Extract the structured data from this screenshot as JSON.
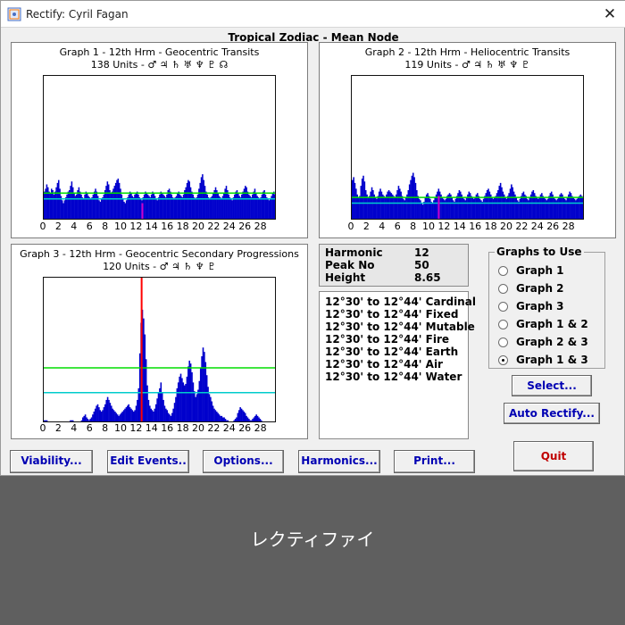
{
  "window": {
    "title": "Rectify: Cyril Fagan",
    "close_symbol": "✕",
    "icon": "app-icon"
  },
  "main_title": "Tropical Zodiac - Mean Node",
  "graphs": [
    {
      "title": "Graph 1 - 12th Hrm - Geocentric Transits",
      "subtitle": "138 Units - ♂ ♃ ♄ ♅ ♆ ♇ ☊",
      "x_labels": [
        "0",
        "2",
        "4",
        "6",
        "8",
        "10",
        "12",
        "14",
        "16",
        "18",
        "20",
        "22",
        "24",
        "26",
        "28"
      ]
    },
    {
      "title": "Graph 2 - 12th Hrm - Heliocentric Transits",
      "subtitle": "119 Units - ♂ ♃ ♄ ♅ ♆ ♇",
      "x_labels": [
        "0",
        "2",
        "4",
        "6",
        "8",
        "10",
        "12",
        "14",
        "16",
        "18",
        "20",
        "22",
        "24",
        "26",
        "28"
      ]
    },
    {
      "title": "Graph 3 - 12th Hrm - Geocentric Secondary Progressions",
      "subtitle": "120 Units - ♂ ♃ ♄ ♆ ♇",
      "x_labels": [
        "0",
        "2",
        "4",
        "6",
        "8",
        "10",
        "12",
        "14",
        "16",
        "18",
        "20",
        "22",
        "24",
        "26",
        "28"
      ]
    }
  ],
  "info": {
    "rows": [
      {
        "label": "Harmonic",
        "value": "12"
      },
      {
        "label": "Peak No",
        "value": "50"
      },
      {
        "label": "Height",
        "value": "8.65"
      }
    ]
  },
  "ranges": [
    "12°30' to 12°44' Cardinal",
    "12°30' to 12°44' Fixed",
    "12°30' to 12°44' Mutable",
    "12°30' to 12°44' Fire",
    "12°30' to 12°44' Earth",
    "12°30' to 12°44' Air",
    "12°30' to 12°44' Water"
  ],
  "graphs_to_use": {
    "title": "Graphs to Use",
    "options": [
      "Graph 1",
      "Graph 2",
      "Graph 3",
      "Graph 1 & 2",
      "Graph 2 & 3",
      "Graph 1 & 3"
    ],
    "selected_index": 5
  },
  "buttons": {
    "select": "Select...",
    "auto_rectify": "Auto Rectify...",
    "viability": "Viability...",
    "edit_events": "Edit Events..",
    "options": "Options...",
    "harmonics": "Harmonics...",
    "print": "Print...",
    "quit": "Quit"
  },
  "caption": "レクティファイ",
  "colors": {
    "bars": "#0000cc",
    "red_marker": "#ff0000",
    "magenta_marker": "#cc00cc",
    "green_line": "#00dd00",
    "cyan_line": "#00cccc"
  },
  "chart_data": [
    {
      "type": "bar",
      "title": "Graph 1 - 12th Hrm - Geocentric Transits",
      "subtitle": "138 Units - ♂ ♃ ♄ ♅ ♆ ♇ ☊",
      "xlim": [
        0,
        30
      ],
      "ylim": [
        0,
        10
      ],
      "x_ticks": [
        0,
        2,
        4,
        6,
        8,
        10,
        12,
        14,
        16,
        18,
        20,
        22,
        24,
        26,
        28
      ],
      "reference_lines": [
        1.9,
        1.5
      ],
      "marker_x": 12.7,
      "marker_y": 1.2,
      "values": [
        2.0,
        2.2,
        2.5,
        2.3,
        2.0,
        1.9,
        2.2,
        2.1,
        1.8,
        2.0,
        2.3,
        2.6,
        2.8,
        2.2,
        1.7,
        1.4,
        1.2,
        1.4,
        1.6,
        1.8,
        2.0,
        2.1,
        2.4,
        2.7,
        2.3,
        1.9,
        1.7,
        1.8,
        2.1,
        2.3,
        2.0,
        1.8,
        1.6,
        1.5,
        1.8,
        2.0,
        1.9,
        1.7,
        1.6,
        1.5,
        1.6,
        1.8,
        2.0,
        2.2,
        2.0,
        1.7,
        1.4,
        1.3,
        1.5,
        1.6,
        1.8,
        2.1,
        2.4,
        2.7,
        2.5,
        2.1,
        1.9,
        2.0,
        2.2,
        2.4,
        2.6,
        2.8,
        2.9,
        2.6,
        2.2,
        1.8,
        1.5,
        1.3,
        1.2,
        1.4,
        1.6,
        1.8,
        2.0,
        1.9,
        1.7,
        1.6,
        1.8,
        1.9,
        2.0,
        1.8,
        1.6,
        1.5,
        1.4,
        1.6,
        1.8,
        2.0,
        1.9,
        1.8,
        1.7,
        1.6,
        1.8,
        2.0,
        1.9,
        1.7,
        1.5,
        1.4,
        1.6,
        1.8,
        2.0,
        1.9,
        1.8,
        1.7,
        1.6,
        1.8,
        2.1,
        2.2,
        2.0,
        1.8,
        1.6,
        1.5,
        1.6,
        1.7,
        1.9,
        2.0,
        1.8,
        1.7,
        1.6,
        1.8,
        2.1,
        2.3,
        2.6,
        2.8,
        2.7,
        2.3,
        2.0,
        1.8,
        1.6,
        1.5,
        1.6,
        1.8,
        2.2,
        2.6,
        3.0,
        3.2,
        2.8,
        2.4,
        2.0,
        1.8,
        1.6,
        1.5,
        1.6,
        1.7,
        1.9,
        2.1,
        2.3,
        2.1,
        1.9,
        1.7,
        1.6,
        1.5,
        1.7,
        1.9,
        2.2,
        2.4,
        2.1,
        1.8,
        1.6,
        1.5,
        1.4,
        1.6,
        1.8,
        2.0,
        2.1,
        1.9,
        1.7,
        1.6,
        1.8,
        2.0,
        2.2,
        2.4,
        2.3,
        2.0,
        1.8,
        1.7,
        1.6,
        1.8,
        2.0,
        2.2,
        1.9,
        1.7,
        1.6,
        1.5,
        1.6,
        1.8,
        2.0,
        2.1,
        1.8,
        1.6,
        1.5,
        1.4,
        1.5,
        1.7,
        1.9,
        2.0,
        1.8,
        1.6
      ]
    },
    {
      "type": "bar",
      "title": "Graph 2 - 12th Hrm - Heliocentric Transits",
      "subtitle": "119 Units - ♂ ♃ ♄ ♅ ♆ ♇",
      "xlim": [
        0,
        30
      ],
      "ylim": [
        0,
        10
      ],
      "x_ticks": [
        0,
        2,
        4,
        6,
        8,
        10,
        12,
        14,
        16,
        18,
        20,
        22,
        24,
        26,
        28
      ],
      "reference_lines": [
        1.6,
        1.2
      ],
      "marker_x": 11.2,
      "marker_y": 1.7,
      "values": [
        2.8,
        3.0,
        2.6,
        2.2,
        1.8,
        1.6,
        1.7,
        2.4,
        2.9,
        3.1,
        2.7,
        2.1,
        1.8,
        1.6,
        1.7,
        2.0,
        2.3,
        2.1,
        1.8,
        1.6,
        1.5,
        1.7,
        2.0,
        2.2,
        2.0,
        1.8,
        1.7,
        1.6,
        1.8,
        2.0,
        2.1,
        2.0,
        1.9,
        1.8,
        1.7,
        1.6,
        1.8,
        2.1,
        2.4,
        2.2,
        2.0,
        1.7,
        1.5,
        1.4,
        1.6,
        1.8,
        2.1,
        2.5,
        2.8,
        3.1,
        3.3,
        3.0,
        2.6,
        2.1,
        1.7,
        1.5,
        1.4,
        1.2,
        1.1,
        1.3,
        1.6,
        1.8,
        1.9,
        1.7,
        1.5,
        1.3,
        1.2,
        1.4,
        1.6,
        1.8,
        2.0,
        2.2,
        2.0,
        1.8,
        1.6,
        1.5,
        1.4,
        1.5,
        1.7,
        1.8,
        1.9,
        1.8,
        1.6,
        1.4,
        1.3,
        1.5,
        1.7,
        1.9,
        2.1,
        2.0,
        1.8,
        1.6,
        1.5,
        1.4,
        1.6,
        1.8,
        2.0,
        1.9,
        1.7,
        1.6,
        1.5,
        1.6,
        1.8,
        1.9,
        1.7,
        1.5,
        1.4,
        1.3,
        1.5,
        1.7,
        1.9,
        2.1,
        2.2,
        2.0,
        1.8,
        1.6,
        1.5,
        1.6,
        1.7,
        1.9,
        2.1,
        2.4,
        2.6,
        2.3,
        2.0,
        1.8,
        1.6,
        1.5,
        1.7,
        1.9,
        2.2,
        2.5,
        2.3,
        2.0,
        1.8,
        1.6,
        1.4,
        1.3,
        1.5,
        1.7,
        1.9,
        2.0,
        1.8,
        1.7,
        1.5,
        1.4,
        1.6,
        1.8,
        2.0,
        2.1,
        1.9,
        1.7,
        1.6,
        1.5,
        1.6,
        1.8,
        1.9,
        1.7,
        1.6,
        1.5,
        1.4,
        1.5,
        1.7,
        1.9,
        2.0,
        1.8,
        1.6,
        1.5,
        1.4,
        1.5,
        1.6,
        1.8,
        1.9,
        1.8,
        1.6,
        1.5,
        1.4,
        1.6,
        1.8,
        2.0,
        1.9,
        1.7,
        1.6,
        1.5,
        1.4,
        1.5,
        1.6,
        1.7,
        1.8,
        1.7,
        1.6,
        1.5
      ]
    },
    {
      "type": "bar",
      "title": "Graph 3 - 12th Hrm - Geocentric Secondary Progressions",
      "subtitle": "120 Units - ♂ ♃ ♄ ♆ ♇",
      "xlim": [
        0,
        30
      ],
      "ylim": [
        0,
        10
      ],
      "x_ticks": [
        0,
        2,
        4,
        6,
        8,
        10,
        12,
        14,
        16,
        18,
        20,
        22,
        24,
        26,
        28
      ],
      "reference_lines": [
        3.8,
        2.1
      ],
      "marker_x": 12.6,
      "marker_y": 10.0,
      "values": [
        0.2,
        0.2,
        0.2,
        0.1,
        0.1,
        0.1,
        0.1,
        0.1,
        0.1,
        0.1,
        0.1,
        0.1,
        0.1,
        0.1,
        0.1,
        0.1,
        0.1,
        0.1,
        0.1,
        0.1,
        0.1,
        0.2,
        0.2,
        0.2,
        0.1,
        0.1,
        0.1,
        0.1,
        0.1,
        0.1,
        0.2,
        0.4,
        0.5,
        0.6,
        0.4,
        0.3,
        0.2,
        0.3,
        0.4,
        0.6,
        0.8,
        1.0,
        1.2,
        1.3,
        1.1,
        0.9,
        0.8,
        0.9,
        1.1,
        1.3,
        1.6,
        1.8,
        1.6,
        1.4,
        1.2,
        1.0,
        0.9,
        0.8,
        0.7,
        0.6,
        0.5,
        0.6,
        0.7,
        0.8,
        0.9,
        1.0,
        1.1,
        1.2,
        1.3,
        1.1,
        1.0,
        0.9,
        0.8,
        0.9,
        1.2,
        1.6,
        2.4,
        4.8,
        6.9,
        7.8,
        7.2,
        6.1,
        4.4,
        2.6,
        1.6,
        1.2,
        1.0,
        0.9,
        0.8,
        1.0,
        1.3,
        1.7,
        2.1,
        2.4,
        2.8,
        2.1,
        1.6,
        1.2,
        1.0,
        0.9,
        0.7,
        0.6,
        0.5,
        0.7,
        1.0,
        1.4,
        1.8,
        2.4,
        2.8,
        3.2,
        3.4,
        3.1,
        2.8,
        2.6,
        2.7,
        3.2,
        3.9,
        4.3,
        4.1,
        3.5,
        2.8,
        2.2,
        1.8,
        2.0,
        2.3,
        2.9,
        3.8,
        4.6,
        5.2,
        4.9,
        4.2,
        3.3,
        2.5,
        2.0,
        1.8,
        1.5,
        1.2,
        1.0,
        0.9,
        0.8,
        0.7,
        0.6,
        0.5,
        0.5,
        0.4,
        0.4,
        0.3,
        0.2,
        0.2,
        0.1,
        0.1,
        0.1,
        0.1,
        0.2,
        0.3,
        0.4,
        0.7,
        0.9,
        1.1,
        1.0,
        0.9,
        0.8,
        0.7,
        0.5,
        0.4,
        0.3,
        0.2,
        0.2,
        0.3,
        0.4,
        0.5,
        0.6,
        0.5,
        0.4,
        0.3,
        0.2,
        0.1,
        0.1,
        0.1,
        0.1,
        0.1,
        0.1,
        0.1,
        0.1,
        0.1,
        0.1,
        0.1,
        0.1
      ]
    }
  ]
}
